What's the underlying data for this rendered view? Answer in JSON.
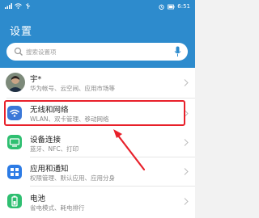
{
  "status_bar": {
    "carrier_icons": [
      "signal-icon",
      "wifi-icon",
      "usb-icon"
    ],
    "right_icons": [
      "alarm-icon",
      "battery-icon"
    ],
    "time": "6:51"
  },
  "header": {
    "title": "设置",
    "background_color": "#2d8bcd"
  },
  "search": {
    "placeholder": "搜索设置项"
  },
  "profile": {
    "name": "宇*",
    "subtitle": "华为帐号、云空间、应用市场等"
  },
  "items": [
    {
      "title": "无线和网络",
      "subtitle": "WLAN、双卡管理、移动网络",
      "icon": "wifi-icon",
      "icon_color": "#3b78d8"
    },
    {
      "title": "设备连接",
      "subtitle": "蓝牙、NFC、打印",
      "icon": "device-connection-icon",
      "icon_color": "#2fbf71"
    },
    {
      "title": "应用和通知",
      "subtitle": "权限管理、默认应用、应用分身",
      "icon": "apps-icon",
      "icon_color": "#2c7be5"
    },
    {
      "title": "电池",
      "subtitle": "省电模式、耗电排行",
      "icon": "battery-icon",
      "icon_color": "#2fbf71"
    }
  ],
  "annotation": {
    "highlight_color": "#e8202a"
  }
}
